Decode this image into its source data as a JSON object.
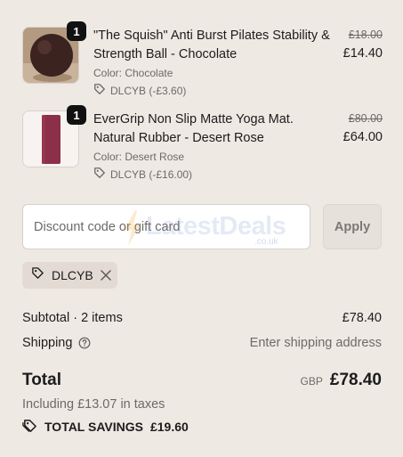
{
  "items": [
    {
      "qty": "1",
      "title": "\"The Squish\" Anti Burst Pilates Stability & Strength Ball - Chocolate",
      "variant": "Color: Chocolate",
      "discount": "DLCYB (-£3.60)",
      "price_old": "£18.00",
      "price_now": "£14.40",
      "image_icon": "chocolate-ball-image"
    },
    {
      "qty": "1",
      "title": "EverGrip Non Slip Matte Yoga Mat. Natural Rubber - Desert Rose",
      "variant": "Color: Desert Rose",
      "discount": "DLCYB (-£16.00)",
      "price_old": "£80.00",
      "price_now": "£64.00",
      "image_icon": "yoga-mat-image"
    }
  ],
  "discount": {
    "placeholder": "Discount code or gift card",
    "apply_label": "Apply"
  },
  "watermark": {
    "text": "LatestDeals",
    "sub": ".co.uk"
  },
  "applied_code": {
    "code": "DLCYB"
  },
  "summary": {
    "subtotal_label": "Subtotal · 2 items",
    "subtotal_value": "£78.40",
    "shipping_label": "Shipping",
    "shipping_value": "Enter shipping address",
    "total_label": "Total",
    "currency": "GBP",
    "total_value": "£78.40",
    "taxes": "Including £13.07 in taxes",
    "savings_label": "TOTAL SAVINGS",
    "savings_value": "£19.60"
  },
  "colors": {
    "background": "#efe9e4",
    "ball": "#3b2320",
    "mat": "#8c2f48",
    "chip": "#e2dad3"
  }
}
